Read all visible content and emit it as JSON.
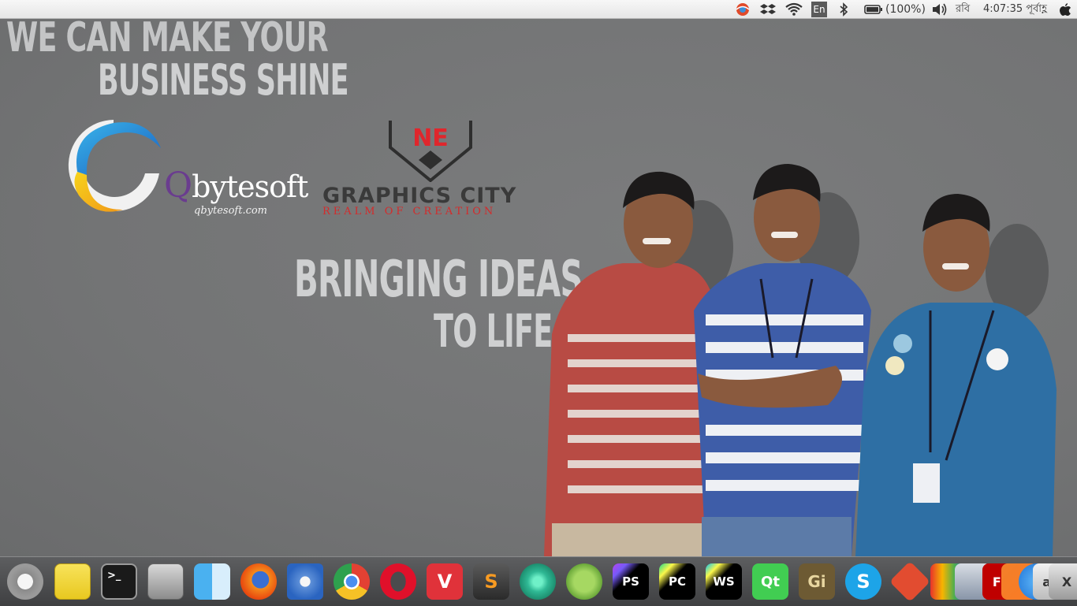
{
  "menubar": {
    "keyboard_layout": "En",
    "battery": "(100%)",
    "day": "রবি",
    "time": "4:07:35 পূর্বাহ্ণ",
    "icons": [
      "app-indicator-icon",
      "dropbox-icon",
      "wifi-icon",
      "keyboard-layout-icon",
      "bluetooth-icon",
      "battery-icon",
      "volume-icon",
      "apple-logo-icon"
    ]
  },
  "wallpaper": {
    "headline_line1": "WE CAN MAKE YOUR",
    "headline_line2": "BUSINESS SHINE",
    "tagline_line1": "BRINGING IDEAS",
    "tagline_line2": "TO LIFE",
    "qbytesoft": {
      "logo_q": "Q",
      "logo_rest": "bytesoft",
      "url": "qbytesoft.com"
    },
    "graphics_city": {
      "mark": "NE",
      "name": "GRAPHICS CITY",
      "tagline": "REALM OF CREATION"
    }
  },
  "dock": {
    "items": [
      {
        "name": "ubuntu-icon",
        "label": ""
      },
      {
        "name": "sticky-notes-icon",
        "label": ""
      },
      {
        "name": "terminal-icon",
        "label": ">_"
      },
      {
        "name": "disk-drive-icon",
        "label": ""
      },
      {
        "name": "finder-icon",
        "label": ""
      },
      {
        "name": "firefox-icon",
        "label": ""
      },
      {
        "name": "safari-icon",
        "label": ""
      },
      {
        "name": "chrome-icon",
        "label": ""
      },
      {
        "name": "opera-icon",
        "label": ""
      },
      {
        "name": "vivaldi-icon",
        "label": "V"
      },
      {
        "name": "sublime-text-icon",
        "label": "S"
      },
      {
        "name": "atom-icon",
        "label": ""
      },
      {
        "name": "android-studio-icon",
        "label": ""
      },
      {
        "name": "phpstorm-icon",
        "label": "PS"
      },
      {
        "name": "pycharm-icon",
        "label": "PC"
      },
      {
        "name": "webstorm-icon",
        "label": "WS"
      },
      {
        "name": "qt-creator-icon",
        "label": "Qt"
      },
      {
        "name": "gimp-icon",
        "label": "Gi"
      },
      {
        "name": "skype-icon",
        "label": "S"
      },
      {
        "name": "git-icon",
        "label": ""
      },
      {
        "name": "app-icon-1",
        "label": ""
      },
      {
        "name": "app-icon-2",
        "label": ""
      },
      {
        "name": "filezilla-icon",
        "label": "Fz"
      },
      {
        "name": "xampp-icon",
        "label": ""
      },
      {
        "name": "app-store-icon",
        "label": ""
      },
      {
        "name": "font-viewer-icon",
        "label": "aa"
      },
      {
        "name": "app-icon-3",
        "label": "X"
      }
    ]
  },
  "colors": {
    "desktop": "#767778",
    "headline": "#cfd0d1",
    "qbytesoft_purple": "#6a3c8f",
    "graphics_city_red": "#d42b2b",
    "dock": "#4a4b4d"
  }
}
